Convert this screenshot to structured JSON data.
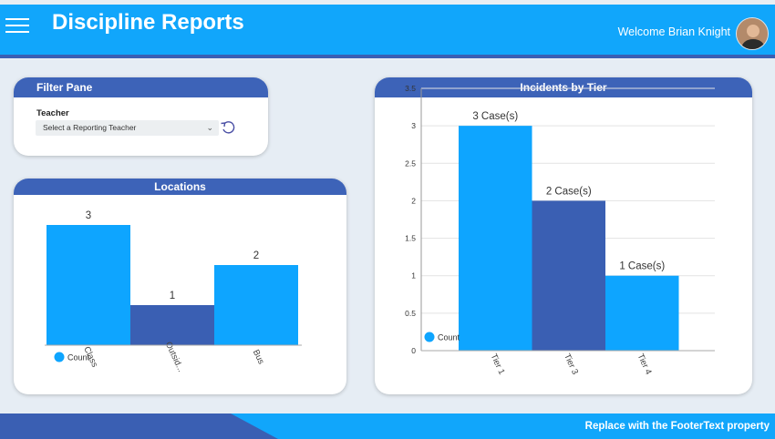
{
  "header": {
    "title": "Discipline Reports",
    "welcome": "Welcome Brian Knight",
    "menu_icon": "hamburger-menu-icon"
  },
  "filter_pane": {
    "title": "Filter Pane",
    "teacher_label": "Teacher",
    "teacher_placeholder": "Select a Reporting Teacher",
    "reset_icon": "reset-icon"
  },
  "footer": {
    "text": "Replace with the FooterText property"
  },
  "colors": {
    "header": "#11a6fb",
    "card_header": "#3d63b8",
    "bar_light": "#0ea5ff",
    "bar_dark": "#3a5fb3"
  },
  "chart_data": [
    {
      "type": "bar",
      "title": "Locations",
      "categories": [
        "Class",
        "Outsid...",
        "Bus"
      ],
      "values": [
        3,
        1,
        2
      ],
      "data_labels": [
        "3",
        "1",
        "2"
      ],
      "legend": [
        "Count"
      ],
      "legend_placement": "bottom-left",
      "colors": [
        "#0ea5ff",
        "#3a5fb3",
        "#0ea5ff"
      ],
      "ylim": [
        0,
        3.5
      ]
    },
    {
      "type": "bar",
      "title": "Incidents by Tier",
      "categories": [
        "Tier 1",
        "Tier 3",
        "Tier 4"
      ],
      "values": [
        3,
        2,
        1
      ],
      "data_labels": [
        "3 Case(s)",
        "2 Case(s)",
        "1 Case(s)"
      ],
      "legend": [
        "Count"
      ],
      "legend_placement": "bottom-left",
      "colors": [
        "#0ea5ff",
        "#3a5fb3",
        "#0ea5ff"
      ],
      "ylim": [
        0,
        3.5
      ],
      "yticks": [
        "0",
        "0.5",
        "1",
        "1.5",
        "2",
        "2.5",
        "3",
        "3.5"
      ],
      "grid": true
    }
  ]
}
